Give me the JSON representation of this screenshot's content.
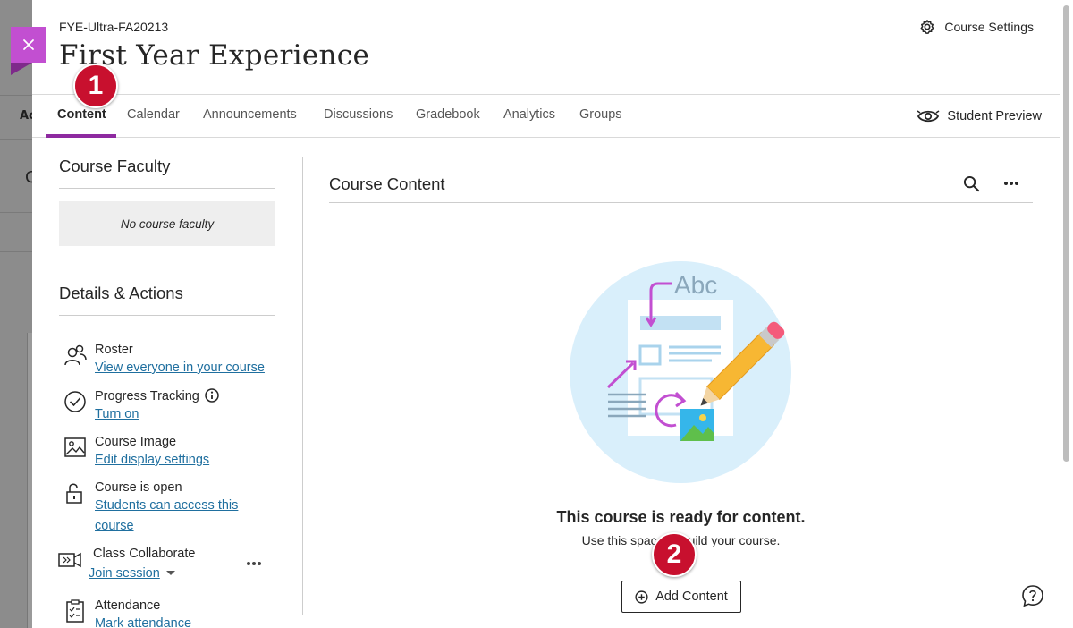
{
  "header": {
    "course_code": "FYE-Ultra-FA20213",
    "course_title": "First Year Experience",
    "settings_label": "Course Settings"
  },
  "background": {
    "tab_fragment": "Ac",
    "letter_fragment": "C"
  },
  "tabs": [
    {
      "label": "Content",
      "active": true
    },
    {
      "label": "Calendar"
    },
    {
      "label": "Announcements"
    },
    {
      "label": "Discussions"
    },
    {
      "label": "Gradebook"
    },
    {
      "label": "Analytics"
    },
    {
      "label": "Groups"
    }
  ],
  "student_preview_label": "Student Preview",
  "badges": [
    "1",
    "2"
  ],
  "faculty": {
    "heading": "Course Faculty",
    "empty_text": "No course faculty"
  },
  "details": {
    "heading": "Details & Actions",
    "items": [
      {
        "icon": "roster-icon",
        "title": "Roster",
        "link": "View everyone in your course"
      },
      {
        "icon": "progress-check-icon",
        "title": "Progress Tracking",
        "link": "Turn on"
      },
      {
        "icon": "image-icon",
        "title": "Course Image",
        "link": "Edit display settings"
      },
      {
        "icon": "unlock-icon",
        "title": "Course is open",
        "link_line1": "Students can access this",
        "link_line2": "course"
      },
      {
        "icon": "collaborate-icon",
        "title": "Class Collaborate",
        "link": "Join session"
      },
      {
        "icon": "attendance-icon",
        "title": "Attendance",
        "link": "Mark attendance"
      }
    ]
  },
  "content": {
    "heading": "Course Content",
    "illustration_text": "Abc",
    "empty_title": "This course is ready for content.",
    "empty_subtitle": "Use this space to build your course.",
    "add_button": "Add Content"
  },
  "colors": {
    "accent": "#8e2aa0",
    "close_flag": "#c24fd1",
    "link": "#1f6f9f",
    "badge": "#c8102e"
  }
}
